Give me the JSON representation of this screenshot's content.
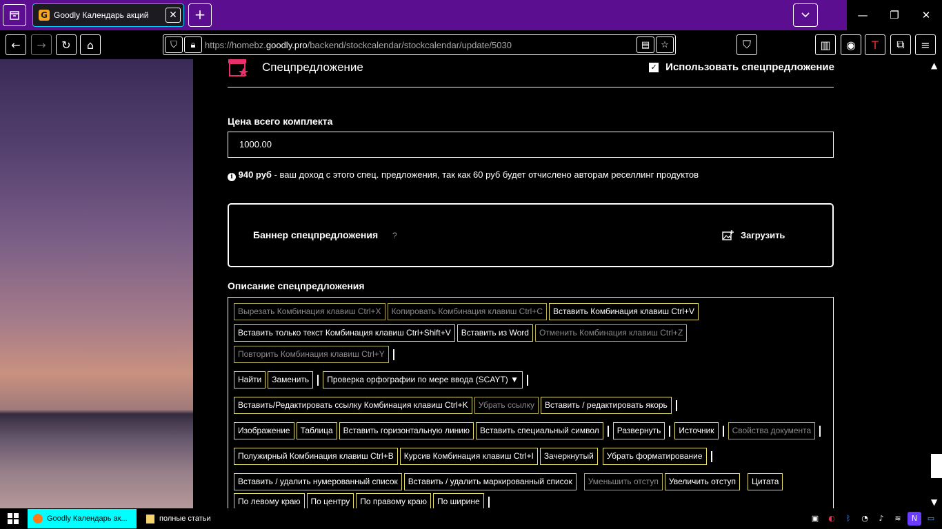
{
  "browser": {
    "tab_title": "Goodly Календарь акций",
    "tab_favicon": "G",
    "url_prefix": "https://homebz.",
    "url_domain": "goodly.pro",
    "url_path": "/backend/stockcalendar/stockcalendar/update/5030"
  },
  "section": {
    "title": "Спецпредложение",
    "use_special_label": "Использовать спецпредложение",
    "use_special_checked": "✓"
  },
  "price": {
    "label": "Цена всего комплекта",
    "value": "1000.00"
  },
  "info": {
    "icon": "i",
    "amount": "940 руб",
    "text": " - ваш доход с этого спец. предложения, так как 60 руб будет отчислено авторам реселлинг продуктов"
  },
  "banner": {
    "label": "Баннер спецпредложения",
    "help": "?",
    "upload_label": "Загрузить"
  },
  "description": {
    "label": "Описание спецпредложения",
    "toolbar": {
      "cut": "Вырезать Комбинация клавиш Ctrl+X",
      "copy": "Копировать Комбинация клавиш Ctrl+C",
      "paste": "Вставить Комбинация клавиш Ctrl+V",
      "paste_text": "Вставить только текст Комбинация клавиш Ctrl+Shift+V",
      "paste_word": "Вставить из Word",
      "undo": "Отменить Комбинация клавиш Ctrl+Z",
      "redo": "Повторить Комбинация клавиш Ctrl+Y",
      "find": "Найти",
      "replace": "Заменить",
      "scayt": "Проверка орфографии по мере ввода (SCAYT) ▼",
      "link": "Вставить/Редактировать ссылку Комбинация клавиш Ctrl+K",
      "unlink": "Убрать ссылку",
      "anchor": "Вставить / редактировать якорь",
      "image": "Изображение",
      "table": "Таблица",
      "hr": "Вставить горизонтальную линию",
      "special_char": "Вставить специальный символ",
      "maximize": "Развернуть",
      "source": "Источник",
      "doc_props": "Свойства документа",
      "bold": "Полужирный Комбинация клавиш Ctrl+B",
      "italic": "Курсив Комбинация клавиш Ctrl+I",
      "strike": "Зачеркнутый",
      "remove_format": "Убрать форматирование",
      "numbered_list": "Вставить / удалить нумерованный список",
      "bulleted_list": "Вставить / удалить маркированный список",
      "outdent": "Уменьшить отступ",
      "indent": "Увеличить отступ",
      "blockquote": "Цитата",
      "align_left": "По левому краю",
      "align_center": "По центру",
      "align_right": "По правому краю",
      "justify": "По ширине"
    }
  },
  "taskbar": {
    "firefox_label": "Goodly Календарь ак...",
    "folder_label": "полные статьи"
  }
}
